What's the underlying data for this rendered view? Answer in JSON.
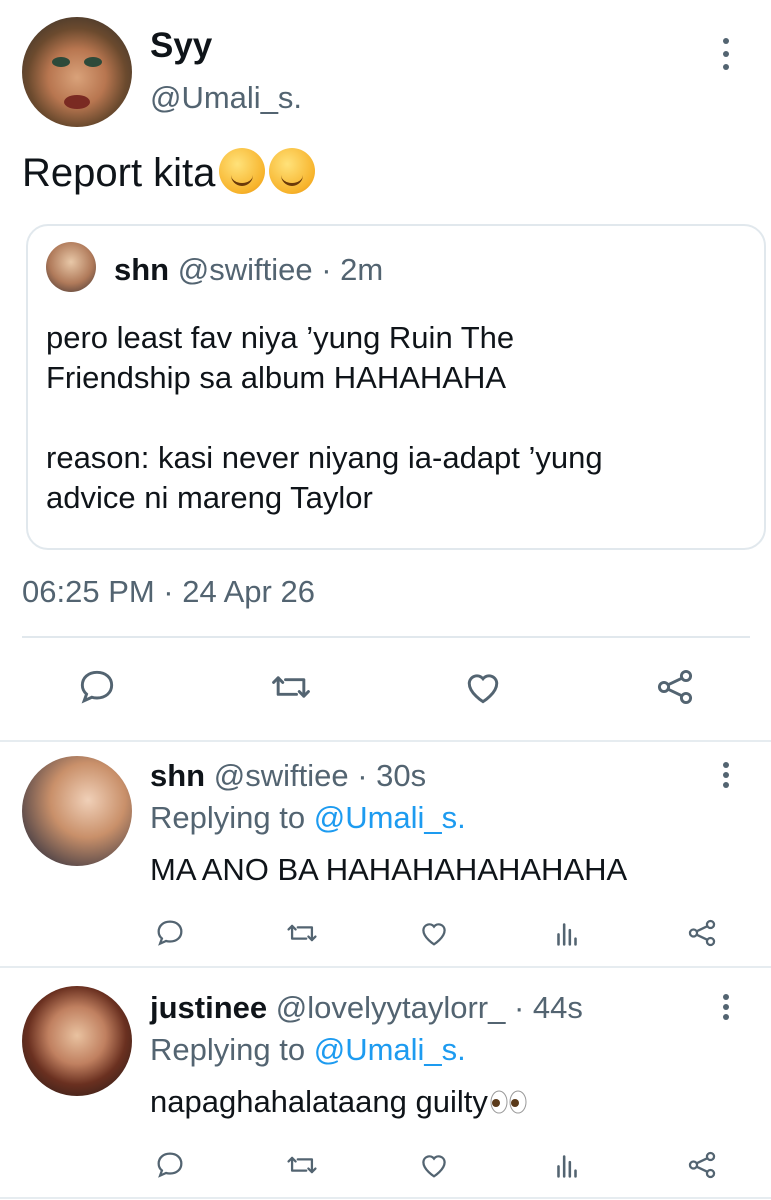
{
  "main_tweet": {
    "name": "Syy",
    "handle": "@Umali_s.",
    "text": "Report kita",
    "emoji": [
      "smiling-face-emoji",
      "smiling-face-emoji"
    ],
    "timestamp": "06:25 PM · 24 Apr 26"
  },
  "quote": {
    "name": "shn",
    "meta": " @swiftiee · 2m",
    "text": "pero least fav niya ’yung Ruin The\nFriendship sa album HAHAHAHA\n\nreason: kasi never niyang ia-adapt ’yung\nadvice ni mareng Taylor"
  },
  "actions": [
    "reply-icon",
    "retweet-icon",
    "like-icon",
    "share-icon"
  ],
  "replies": [
    {
      "name": "shn",
      "meta": " @swiftiee · 30s",
      "replying_prefix": "Replying to ",
      "replying_to": "@Umali_s.",
      "text": "MA ANO BA HAHAHAHAHAHAHA"
    },
    {
      "name": "justinee",
      "meta": " @lovelyytaylorr_ · 44s",
      "replying_prefix": "Replying to ",
      "replying_to": "@Umali_s.",
      "text": "napaghahalataang guilty"
    }
  ],
  "colors": {
    "text": "#0f1419",
    "muted": "#536471",
    "link": "#1d9bf0",
    "border": "#e1e8ed"
  }
}
